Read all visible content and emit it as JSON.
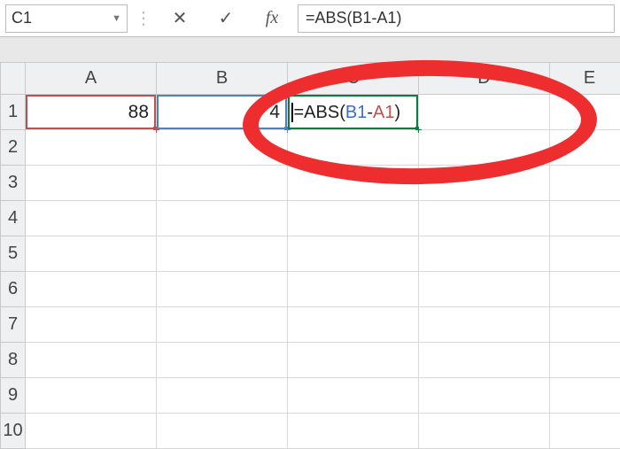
{
  "formula_bar": {
    "name_box": "C1",
    "cancel_glyph": "✕",
    "confirm_glyph": "✓",
    "fx_glyph": "fx",
    "formula_text": "=ABS(B1-A1)"
  },
  "columns": [
    "A",
    "B",
    "C",
    "D",
    "E"
  ],
  "rows": [
    "1",
    "2",
    "3",
    "4",
    "5",
    "6",
    "7",
    "8",
    "9",
    "10"
  ],
  "cells": {
    "A1": "88",
    "B1": "4",
    "C1_parts": {
      "prefix": "=ABS(",
      "ref1": "B1",
      "minus": "-",
      "ref2": "A1",
      "suffix": ")"
    }
  },
  "active_cell": "C1",
  "annotation": {
    "red_ellipse": true
  }
}
